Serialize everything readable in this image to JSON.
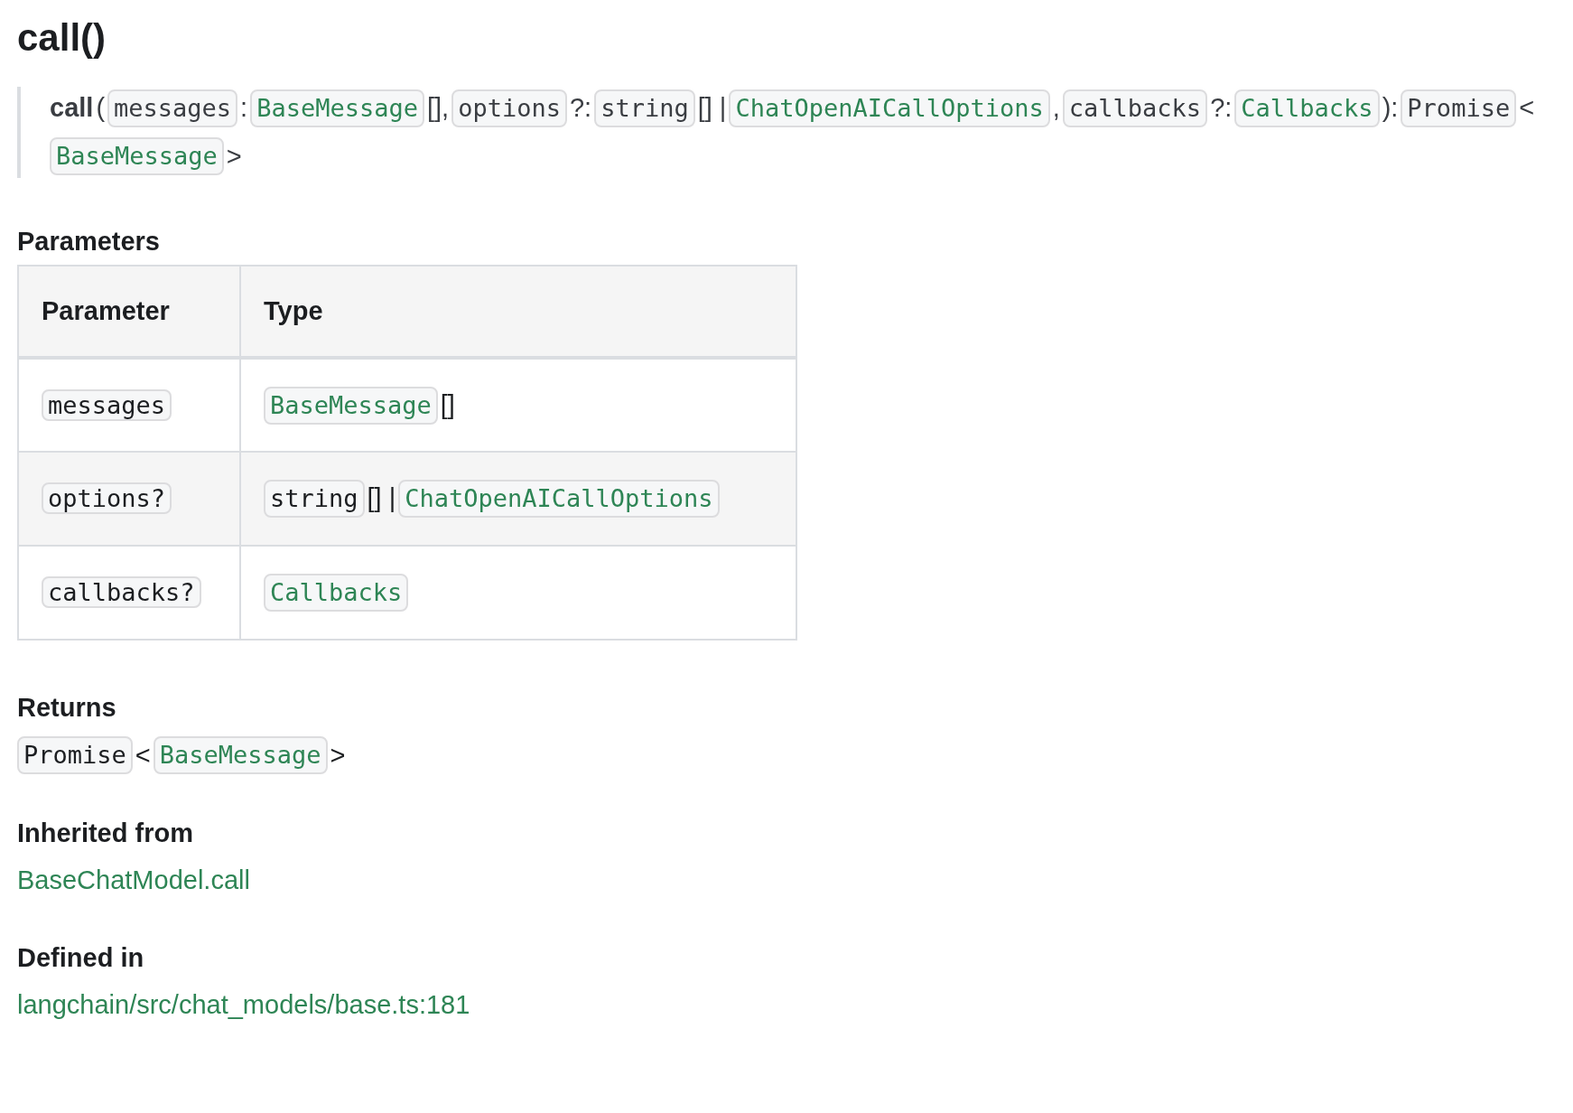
{
  "title": "call()",
  "signature": [
    {
      "kind": "name",
      "text": "call"
    },
    {
      "kind": "text",
      "text": "("
    },
    {
      "kind": "code",
      "text": "messages"
    },
    {
      "kind": "text",
      "text": ":"
    },
    {
      "kind": "ref",
      "text": "BaseMessage"
    },
    {
      "kind": "text",
      "text": "[],"
    },
    {
      "kind": "code",
      "text": "options"
    },
    {
      "kind": "text",
      "text": "?:"
    },
    {
      "kind": "code",
      "text": "string"
    },
    {
      "kind": "text",
      "text": "[] |"
    },
    {
      "kind": "ref",
      "text": "ChatOpenAICallOptions"
    },
    {
      "kind": "text",
      "text": ","
    },
    {
      "kind": "code",
      "text": "callbacks"
    },
    {
      "kind": "text",
      "text": "?:"
    },
    {
      "kind": "ref",
      "text": "Callbacks"
    },
    {
      "kind": "text",
      "text": "):"
    },
    {
      "kind": "code",
      "text": "Promise"
    },
    {
      "kind": "text",
      "text": "<"
    },
    {
      "kind": "ref",
      "text": "BaseMessage"
    },
    {
      "kind": "text",
      "text": ">"
    }
  ],
  "parameters": {
    "heading": "Parameters",
    "columns": [
      "Parameter",
      "Type"
    ],
    "rows": [
      {
        "name": "messages",
        "type": [
          {
            "kind": "ref",
            "text": "BaseMessage"
          },
          {
            "kind": "text",
            "text": "[]"
          }
        ]
      },
      {
        "name": "options?",
        "type": [
          {
            "kind": "code",
            "text": "string"
          },
          {
            "kind": "text",
            "text": "[] |"
          },
          {
            "kind": "ref",
            "text": "ChatOpenAICallOptions"
          }
        ]
      },
      {
        "name": "callbacks?",
        "type": [
          {
            "kind": "ref",
            "text": "Callbacks"
          }
        ]
      }
    ]
  },
  "sections": [
    {
      "kind": "type",
      "heading": "Returns",
      "tokens": [
        {
          "kind": "code",
          "text": "Promise"
        },
        {
          "kind": "text",
          "text": "<"
        },
        {
          "kind": "ref",
          "text": "BaseMessage"
        },
        {
          "kind": "text",
          "text": ">"
        }
      ]
    },
    {
      "kind": "link",
      "heading": "Inherited from",
      "link": "BaseChatModel.call"
    },
    {
      "kind": "link",
      "heading": "Defined in",
      "link": "langchain/src/chat_models/base.ts:181"
    }
  ]
}
